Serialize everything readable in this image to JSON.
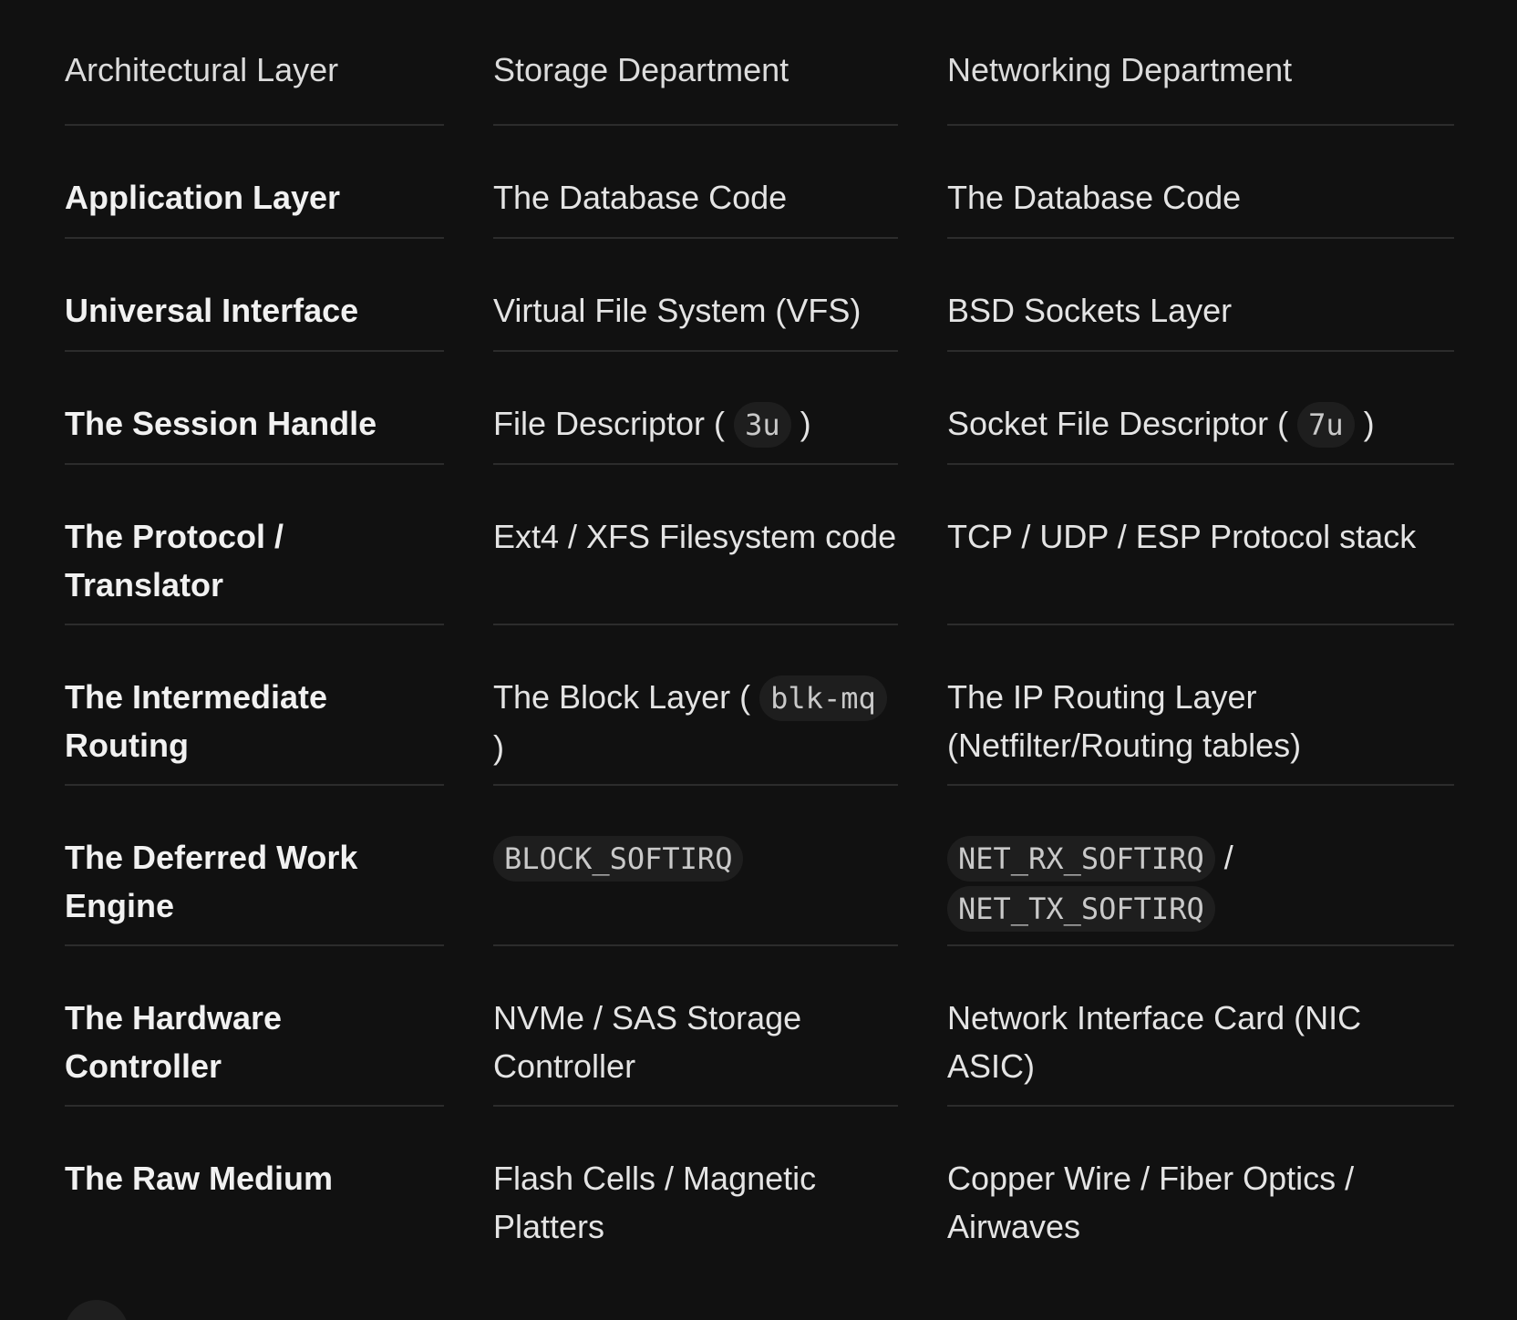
{
  "table": {
    "headers": [
      "Architectural Layer",
      "Storage Department",
      "Networking Department"
    ],
    "rows": [
      {
        "label": "Application Layer",
        "storage": "The Database Code",
        "network": "The Database Code"
      },
      {
        "label": "Universal Interface",
        "storage": "Virtual File System (VFS)",
        "network": "BSD Sockets Layer"
      },
      {
        "label": "The Session Handle",
        "storage_prefix": "File Descriptor (",
        "storage_code": "3u",
        "storage_suffix": ")",
        "network_prefix": "Socket File Descriptor (",
        "network_code": "7u",
        "network_suffix": ")"
      },
      {
        "label": "The Protocol / Translator",
        "storage": "Ext4 / XFS Filesystem code",
        "network": "TCP / UDP / ESP Protocol stack"
      },
      {
        "label": "The Intermediate Routing",
        "storage_prefix": "The Block Layer (",
        "storage_code": "blk-mq",
        "storage_suffix": ")",
        "network": "The IP Routing Layer (Netfilter/Routing tables)"
      },
      {
        "label": "The Deferred Work Engine",
        "storage_code": "BLOCK_SOFTIRQ",
        "network_code_1": "NET_RX_SOFTIRQ",
        "network_separator": "/",
        "network_code_2": "NET_TX_SOFTIRQ"
      },
      {
        "label": "The Hardware Controller",
        "storage": "NVMe / SAS Storage Controller",
        "network": "Network Interface Card (NIC ASIC)"
      },
      {
        "label": "The Raw Medium",
        "storage": "Flash Cells / Magnetic Platters",
        "network": "Copper Wire / Fiber Optics / Airwaves"
      }
    ]
  },
  "more_button": {
    "label": "..."
  }
}
